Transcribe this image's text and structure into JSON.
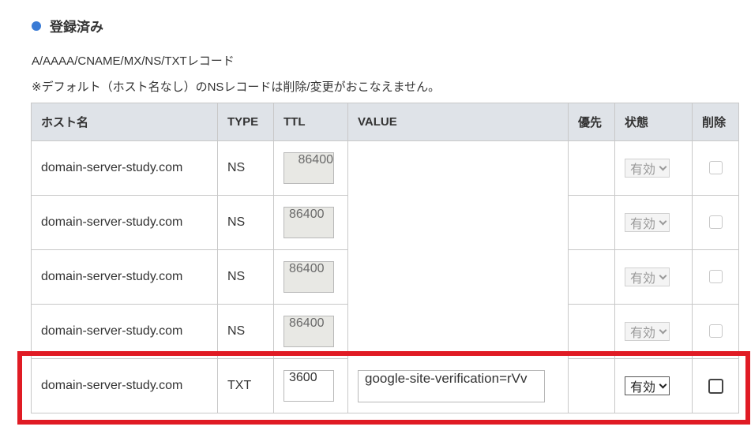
{
  "section": {
    "title": "登録済み"
  },
  "description": {
    "line1": "A/AAAA/CNAME/MX/NS/TXTレコード",
    "line2": "※デフォルト（ホスト名なし）のNSレコードは削除/変更がおこなえません。"
  },
  "table": {
    "headers": {
      "host": "ホスト名",
      "type": "TYPE",
      "ttl": "TTL",
      "value": "VALUE",
      "priority": "優先",
      "state": "状態",
      "delete": "削除"
    },
    "rows": [
      {
        "host": "domain-server-study.com",
        "type": "NS",
        "ttl": "86400",
        "value": "",
        "priority": "",
        "state": "有効",
        "editable": false
      },
      {
        "host": "domain-server-study.com",
        "type": "NS",
        "ttl": "86400",
        "value": "",
        "priority": "",
        "state": "有効",
        "editable": false
      },
      {
        "host": "domain-server-study.com",
        "type": "NS",
        "ttl": "86400",
        "value": "",
        "priority": "",
        "state": "有効",
        "editable": false
      },
      {
        "host": "domain-server-study.com",
        "type": "NS",
        "ttl": "86400",
        "value": "",
        "priority": "",
        "state": "有効",
        "editable": false
      },
      {
        "host": "domain-server-study.com",
        "type": "TXT",
        "ttl": "3600",
        "value": "google-site-verification=rVv",
        "priority": "",
        "state": "有効",
        "editable": true
      }
    ]
  },
  "colors": {
    "bullet": "#3a7bd5",
    "header_bg": "#dfe3e8",
    "highlight": "#e01b24"
  },
  "icons": {
    "bullet": "circle-bullet-icon",
    "dropdown": "chevron-down-icon"
  }
}
